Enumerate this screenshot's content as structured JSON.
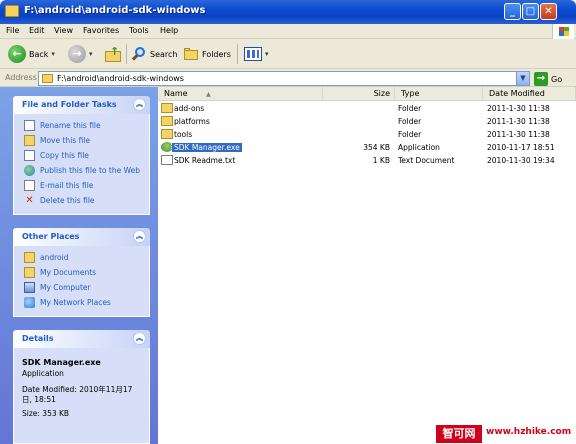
{
  "window": {
    "title": "F:\\android\\android-sdk-windows",
    "min_symbol": "_",
    "max_symbol": "□",
    "close_symbol": "✕"
  },
  "menu": [
    "File",
    "Edit",
    "View",
    "Favorites",
    "Tools",
    "Help"
  ],
  "toolbar": {
    "back_label": "Back",
    "search_label": "Search",
    "folders_label": "Folders"
  },
  "address": {
    "label": "Address",
    "value": "F:\\android\\android-sdk-windows",
    "go_label": "Go"
  },
  "tasks_panel": {
    "title": "File and Folder Tasks",
    "items": [
      {
        "label": "Rename this file",
        "icon": "rename-icon"
      },
      {
        "label": "Move this file",
        "icon": "folder-icon"
      },
      {
        "label": "Copy this file",
        "icon": "copy-icon"
      },
      {
        "label": "Publish this file to the Web",
        "icon": "globe-icon"
      },
      {
        "label": "E-mail this file",
        "icon": "mail-icon"
      },
      {
        "label": "Delete this file",
        "icon": "delete-icon"
      }
    ]
  },
  "places_panel": {
    "title": "Other Places",
    "items": [
      {
        "label": "android",
        "icon": "folder-icon"
      },
      {
        "label": "My Documents",
        "icon": "folder-icon"
      },
      {
        "label": "My Computer",
        "icon": "computer-icon"
      },
      {
        "label": "My Network Places",
        "icon": "network-icon"
      }
    ]
  },
  "details_panel": {
    "title": "Details",
    "name": "SDK Manager.exe",
    "type": "Application",
    "modified": "Date Modified: 2010年11月17日, 18:51",
    "size": "Size: 353 KB"
  },
  "columns": {
    "name": "Name",
    "size": "Size",
    "type": "Type",
    "date": "Date Modified",
    "sort_glyph": "▲"
  },
  "files": [
    {
      "name": "add-ons",
      "size": "",
      "type": "Folder",
      "date": "2011-1-30 11:38",
      "icon": "folder-icon"
    },
    {
      "name": "platforms",
      "size": "",
      "type": "Folder",
      "date": "2011-1-30 11:38",
      "icon": "folder-icon"
    },
    {
      "name": "tools",
      "size": "",
      "type": "Folder",
      "date": "2011-1-30 11:38",
      "icon": "folder-icon"
    },
    {
      "name": "SDK Manager.exe",
      "size": "354 KB",
      "type": "Application",
      "date": "2010-11-17 18:51",
      "icon": "exe-icon",
      "selected": true
    },
    {
      "name": "SDK Readme.txt",
      "size": "1 KB",
      "type": "Text Document",
      "date": "2010-11-30 19:34",
      "icon": "text-file-icon"
    }
  ],
  "watermark": {
    "cn": "智可网",
    "url": "www.hzhike.com"
  }
}
